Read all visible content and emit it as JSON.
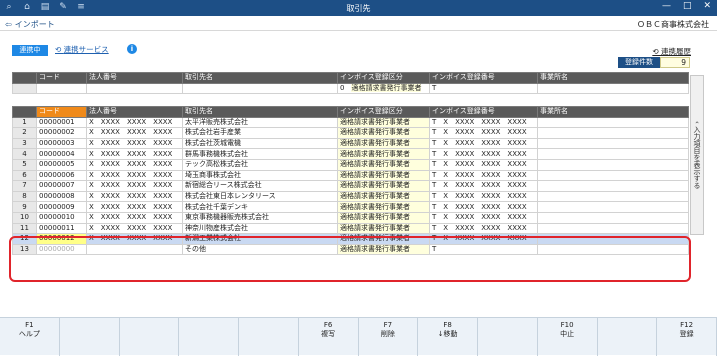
{
  "window": {
    "title": "取引先",
    "company": "ＯＢＣ商事株式会社",
    "import_label": "インポート"
  },
  "toolbar": {
    "mode_label": "連携中",
    "service_link": "連携サービス",
    "history_link": "連携履歴",
    "count_label": "登録件数",
    "count_value": "9"
  },
  "side_label": "入力項目を表示する",
  "summary_header": [
    "コード",
    "法人番号",
    "取引先名",
    "インボイス登録区分",
    "インボイス登録番号",
    "事業所名"
  ],
  "summary_row": {
    "kubun": "0",
    "kubun_name": "適格請求書発行事業者",
    "t": "T"
  },
  "grid_header": [
    "コード",
    "法人番号",
    "取引先名",
    "インボイス登録区分",
    "インボイス登録番号",
    "事業所名"
  ],
  "rows": [
    {
      "n": "1",
      "code": "00000001",
      "corp": "X　XXXX　XXXX　XXXX",
      "name": "太平洋販売株式会社",
      "kubun": "0",
      "kubun_name": "適格請求書発行事業者",
      "reg": "T　X　XXXX　XXXX　XXXX"
    },
    {
      "n": "2",
      "code": "00000002",
      "corp": "X　XXXX　XXXX　XXXX",
      "name": "株式会社岩手産業",
      "kubun": "0",
      "kubun_name": "適格請求書発行事業者",
      "reg": "T　X　XXXX　XXXX　XXXX"
    },
    {
      "n": "3",
      "code": "00000003",
      "corp": "X　XXXX　XXXX　XXXX",
      "name": "株式会社茨城電機",
      "kubun": "0",
      "kubun_name": "適格請求書発行事業者",
      "reg": "T　X　XXXX　XXXX　XXXX"
    },
    {
      "n": "4",
      "code": "00000004",
      "corp": "X　XXXX　XXXX　XXXX",
      "name": "群馬事務機株式会社",
      "kubun": "0",
      "kubun_name": "適格請求書発行事業者",
      "reg": "T　X　XXXX　XXXX　XXXX"
    },
    {
      "n": "5",
      "code": "00000005",
      "corp": "X　XXXX　XXXX　XXXX",
      "name": "テック高松株式会社",
      "kubun": "0",
      "kubun_name": "適格請求書発行事業者",
      "reg": "T　X　XXXX　XXXX　XXXX"
    },
    {
      "n": "6",
      "code": "00000006",
      "corp": "X　XXXX　XXXX　XXXX",
      "name": "埼玉商事株式会社",
      "kubun": "0",
      "kubun_name": "適格請求書発行事業者",
      "reg": "T　X　XXXX　XXXX　XXXX"
    },
    {
      "n": "7",
      "code": "00000007",
      "corp": "X　XXXX　XXXX　XXXX",
      "name": "新宿総合リース株式会社",
      "kubun": "0",
      "kubun_name": "適格請求書発行事業者",
      "reg": "T　X　XXXX　XXXX　XXXX"
    },
    {
      "n": "8",
      "code": "00000008",
      "corp": "X　XXXX　XXXX　XXXX",
      "name": "株式会社東日本レンタリース",
      "kubun": "0",
      "kubun_name": "適格請求書発行事業者",
      "reg": "T　X　XXXX　XXXX　XXXX"
    },
    {
      "n": "9",
      "code": "00000009",
      "corp": "X　XXXX　XXXX　XXXX",
      "name": "株式会社千葉デンキ",
      "kubun": "0",
      "kubun_name": "適格請求書発行事業者",
      "reg": "T　X　XXXX　XXXX　XXXX"
    },
    {
      "n": "10",
      "code": "00000010",
      "corp": "X　XXXX　XXXX　XXXX",
      "name": "東京事務機器販売株式会社",
      "kubun": "0",
      "kubun_name": "適格請求書発行事業者",
      "reg": "T　X　XXXX　XXXX　XXXX"
    },
    {
      "n": "11",
      "code": "00000011",
      "corp": "X　XXXX　XXXX　XXXX",
      "name": "神奈川物産株式会社",
      "kubun": "0",
      "kubun_name": "適格請求書発行事業者",
      "reg": "T　X　XXXX　XXXX　XXXX"
    },
    {
      "n": "12",
      "code": "00000012",
      "corp": "X　XXXX　XXXX　XXXX",
      "name": "新潟工業株式会社",
      "kubun": "0",
      "kubun_name": "適格請求書発行事業者",
      "reg": "T　X　XXXX　XXXX　XXXX"
    },
    {
      "n": "13",
      "code": "00000000",
      "corp": "",
      "name": "その他",
      "kubun": "0",
      "kubun_name": "適格請求書発行事業者",
      "reg": "T"
    }
  ],
  "fkeys": [
    {
      "key": "F1",
      "label": "ヘルプ"
    },
    {
      "key": "",
      "label": ""
    },
    {
      "key": "",
      "label": ""
    },
    {
      "key": "",
      "label": ""
    },
    {
      "key": "",
      "label": ""
    },
    {
      "key": "F6",
      "label": "複写"
    },
    {
      "key": "F7",
      "label": "削除"
    },
    {
      "key": "F8",
      "label": "↓移動"
    },
    {
      "key": "",
      "label": ""
    },
    {
      "key": "F10",
      "label": "中止"
    },
    {
      "key": "",
      "label": ""
    },
    {
      "key": "F12",
      "label": "登録"
    }
  ]
}
